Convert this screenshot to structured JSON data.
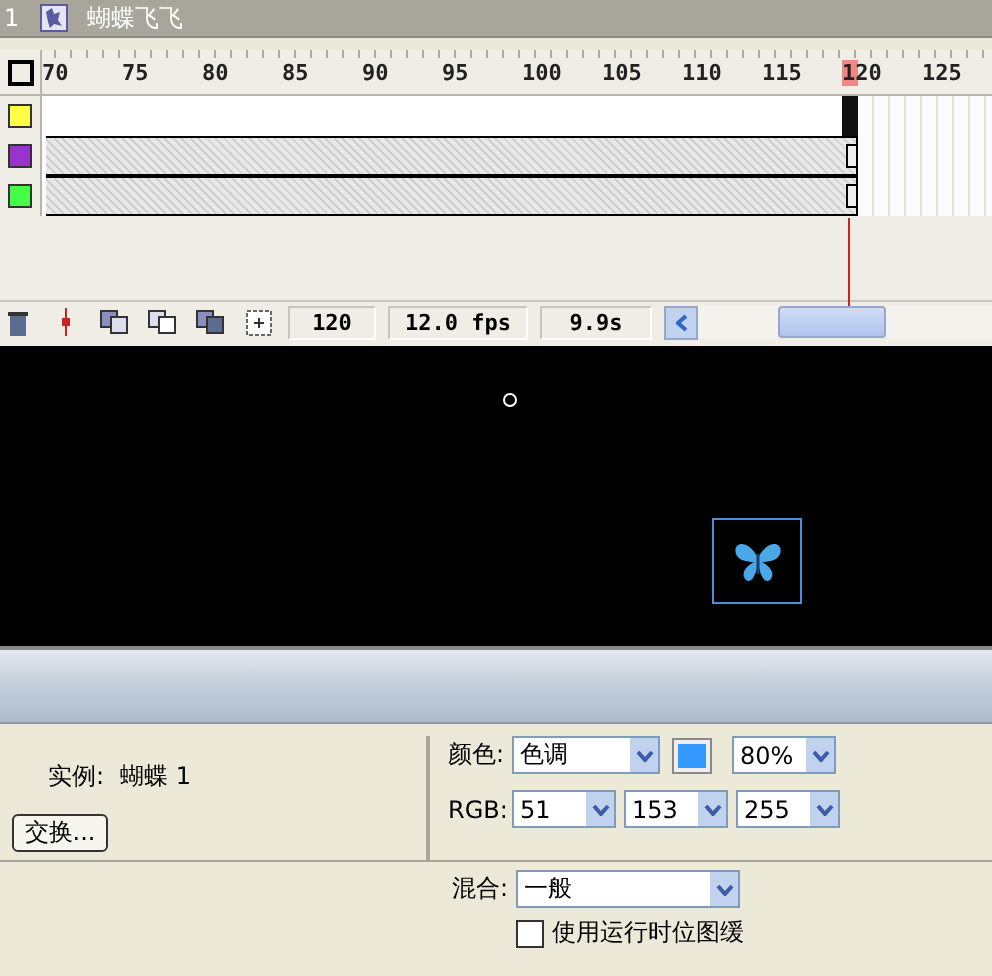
{
  "scene": {
    "number": "1",
    "name": "蝴蝶飞飞"
  },
  "timeline": {
    "ruler": [
      {
        "label": "70",
        "selected": false
      },
      {
        "label": "75",
        "selected": false
      },
      {
        "label": "80",
        "selected": false
      },
      {
        "label": "85",
        "selected": false
      },
      {
        "label": "90",
        "selected": false
      },
      {
        "label": "95",
        "selected": false
      },
      {
        "label": "100",
        "selected": false
      },
      {
        "label": "105",
        "selected": false
      },
      {
        "label": "110",
        "selected": false
      },
      {
        "label": "115",
        "selected": false
      },
      {
        "label": "120",
        "selected": true
      },
      {
        "label": "125",
        "selected": false
      }
    ],
    "layers": [
      {
        "color": "#ffff44",
        "selected": true
      },
      {
        "color": "#9933cc",
        "selected": false
      },
      {
        "color": "#44ff44",
        "selected": false
      }
    ],
    "status": {
      "frame": "120",
      "fps": "12.0 fps",
      "time": "9.9s"
    }
  },
  "properties": {
    "instance_label": "实例:",
    "instance_name": "蝴蝶 1",
    "swap_button": "交换...",
    "color_label": "颜色:",
    "color_mode": "色调",
    "amount": "80%",
    "rgb_label": "RGB:",
    "rgb": [
      "51",
      "153",
      "255"
    ],
    "blend_label": "混合:",
    "blend": "一般",
    "cache_label": "使用运行时位图缓",
    "cache_checked": false
  }
}
